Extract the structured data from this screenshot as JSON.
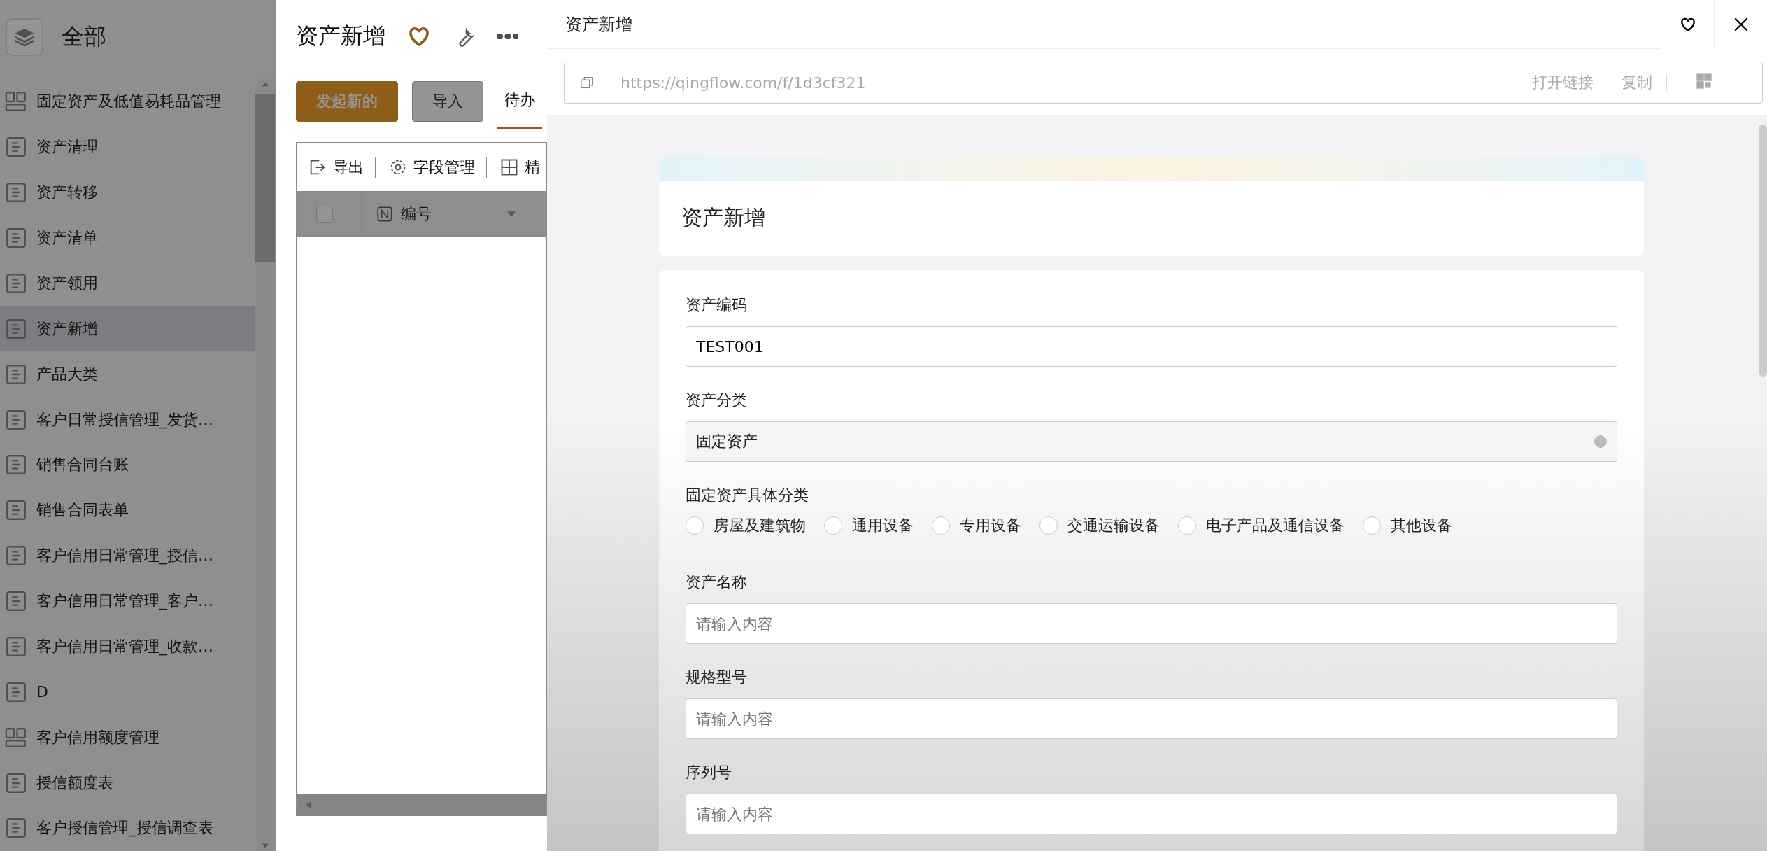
{
  "sidebar": {
    "title": "全部",
    "items": [
      {
        "label": "固定资产及低值易耗品管理",
        "kind": "group",
        "selected": false
      },
      {
        "label": "资产清理",
        "kind": "form",
        "selected": false
      },
      {
        "label": "资产转移",
        "kind": "form",
        "selected": false
      },
      {
        "label": "资产清单",
        "kind": "form",
        "selected": false
      },
      {
        "label": "资产领用",
        "kind": "form",
        "selected": false
      },
      {
        "label": "资产新增",
        "kind": "form",
        "selected": true
      },
      {
        "label": "产品大类",
        "kind": "form",
        "selected": false
      },
      {
        "label": "客户日常授信管理_发货…",
        "kind": "form",
        "selected": false
      },
      {
        "label": "销售合同台账",
        "kind": "form",
        "selected": false
      },
      {
        "label": "销售合同表单",
        "kind": "form",
        "selected": false
      },
      {
        "label": "客户信用日常管理_授信…",
        "kind": "form",
        "selected": false
      },
      {
        "label": "客户信用日常管理_客户…",
        "kind": "form",
        "selected": false
      },
      {
        "label": "客户信用日常管理_收款…",
        "kind": "form",
        "selected": false
      },
      {
        "label": "D",
        "kind": "form",
        "selected": false
      },
      {
        "label": "客户信用额度管理",
        "kind": "group",
        "selected": false
      },
      {
        "label": "授信额度表",
        "kind": "form",
        "selected": false
      },
      {
        "label": "客户授信管理_授信调查表",
        "kind": "form",
        "selected": false
      }
    ]
  },
  "app": {
    "title": "资产新增",
    "buttons": [
      {
        "label": "发起新的",
        "kind": "primary"
      },
      {
        "label": "导入",
        "kind": "default"
      }
    ],
    "tabs": [
      {
        "label": "待办",
        "selected": true
      }
    ],
    "actions": [
      {
        "label": "导出",
        "kind": "export"
      },
      {
        "label": "字段管理",
        "kind": "settings"
      },
      {
        "label": "精",
        "kind": "grid"
      }
    ],
    "select_all": {
      "checked": false
    },
    "columns": [
      {
        "label": "编号"
      }
    ]
  },
  "drawer": {
    "title": "资产新增",
    "url": "https://qingflow.com/f/1d3cf321",
    "url_actions": [
      "打开链接",
      "复制"
    ],
    "form_title": "资产新增",
    "fields": [
      {
        "kind": "text",
        "label": "资产编码",
        "value": "TEST001"
      },
      {
        "kind": "select",
        "label": "资产分类",
        "value": "固定资产"
      },
      {
        "kind": "radio",
        "label": "固定资产具体分类",
        "options": [
          {
            "label": "房屋及建筑物",
            "selected": false
          },
          {
            "label": "通用设备",
            "selected": false
          },
          {
            "label": "专用设备",
            "selected": false
          },
          {
            "label": "交通运输设备",
            "selected": false
          },
          {
            "label": "电子产品及通信设备",
            "selected": false
          },
          {
            "label": "其他设备",
            "selected": false
          }
        ]
      },
      {
        "kind": "text",
        "label": "资产名称",
        "placeholder": "请输入内容"
      },
      {
        "kind": "text",
        "label": "规格型号",
        "placeholder": "请输入内容"
      },
      {
        "kind": "text",
        "label": "序列号",
        "placeholder": "请输入内容"
      }
    ]
  }
}
